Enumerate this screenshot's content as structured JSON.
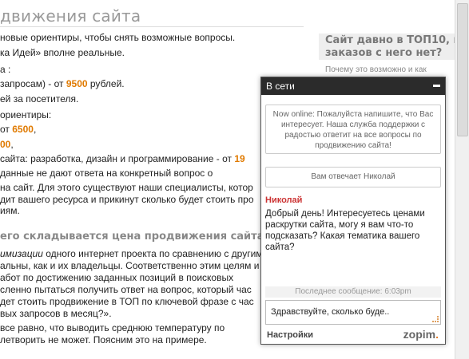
{
  "page": {
    "title": "движения сайта",
    "lines": [
      {
        "pre": "новые ориентиры, чтобы снять возможные вопросы.",
        "hl": "",
        "post": ""
      },
      {
        "pre": "ка Идей» вполне реальные.",
        "hl": "",
        "post": ""
      },
      {
        "pre": "а :",
        "hl": "",
        "post": ""
      },
      {
        "pre": "запросам) - от ",
        "hl": "9500",
        "post": " рублей."
      },
      {
        "pre": "ей за посетителя.",
        "hl": "",
        "post": ""
      },
      {
        "pre": "ориентиры:",
        "hl": "",
        "post": ""
      },
      {
        "pre": "от ",
        "hl": "6500",
        "post": ","
      },
      {
        "pre": "",
        "hl": "00",
        "post": ","
      },
      {
        "pre": "сайта: разработка, дизайн и программирование - от ",
        "hl": "19",
        "post": ""
      },
      {
        "pre": "данные не дают ответа на конкретный вопрос о",
        "hl": "",
        "post": ""
      },
      {
        "pre": "на сайт. Для этого существуют наши специалисты, котор",
        "hl": "",
        "post": ""
      },
      {
        "pre": "дит вашего ресурса и прикинут сколько будет стоить про",
        "hl": "",
        "post": ""
      },
      {
        "pre": "иям.",
        "hl": "",
        "post": ""
      }
    ],
    "subheading": "его складывается цена продвижения сайта",
    "lines2": [
      {
        "em": "имизации",
        "rest": " одного интернет проекта по сравнению с другим"
      },
      {
        "em": "",
        "rest": "альны, как и их владельцы. Соответственно этим целям и"
      },
      {
        "em": "",
        "rest": "абот по достижению заданных позиций в поисковых"
      },
      {
        "em": "",
        "rest": "сленно пытаться получить ответ на вопрос, который час"
      },
      {
        "em": "",
        "rest": "дет стоить продвижение в ТОП по ключевой фразе с час"
      },
      {
        "em": "",
        "rest": "вых запросов в месяц?»."
      },
      {
        "em": "",
        "rest": " все равно, что выводить среднюю температуру по"
      },
      {
        "em": "",
        "rest": "летворить не может. Поясним это на примере."
      }
    ]
  },
  "sidebar": {
    "title_line1": "Сайт давно в ТОП10, но",
    "title_line2": "заказов с него нет?",
    "text": "Почему это возможно и как"
  },
  "chat": {
    "status": "В сети",
    "welcome": "Now online: Пожалуйста напишите, что Вас интересует. Наша служба поддержки с радостью ответит на все вопросы по продвижению сайта!",
    "agent_note": "Вам отвечает Николай",
    "agent_name": "Николай",
    "agent_message": "Добрый день! Интересуетесь ценами раскрутки сайта, могу я вам что-то подсказать? Какая тематика вашего сайта?",
    "last_message": "Последнее сообщение: 6:03pm",
    "input_value": "Здравствуйте, сколько буде..",
    "settings_label": "Настройки",
    "brand": "zopim"
  },
  "colors": {
    "accent": "#e07a00",
    "agent_name": "#cc3333",
    "header_bg": "#2b2b2b"
  }
}
